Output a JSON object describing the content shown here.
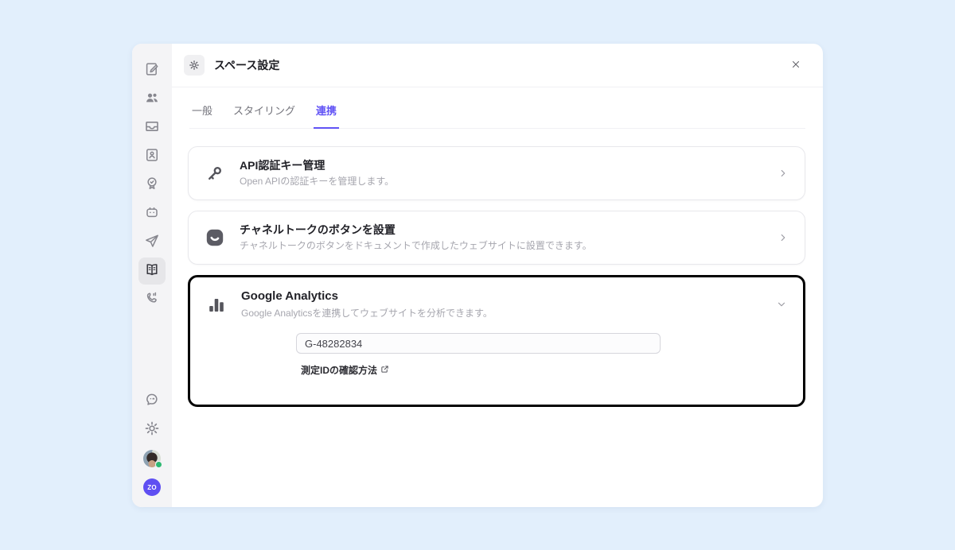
{
  "modal": {
    "title": "スペース設定"
  },
  "tabs": [
    {
      "label": "一般",
      "active": false
    },
    {
      "label": "スタイリング",
      "active": false
    },
    {
      "label": "連携",
      "active": true
    }
  ],
  "cards": {
    "api": {
      "title": "API認証キー管理",
      "subtitle": "Open APIの認証キーを管理します。",
      "chevron": "right"
    },
    "channel_button": {
      "title": "チャネルトークのボタンを設置",
      "subtitle": "チャネルトークのボタンをドキュメントで作成したウェブサイトに設置できます。",
      "chevron": "right"
    },
    "google_analytics": {
      "title": "Google Analytics",
      "subtitle": "Google Analyticsを連携してウェブサイトを分析できます。",
      "chevron": "down",
      "highlighted": true,
      "measurement_id": "G-48282834",
      "help_link": "測定IDの確認方法"
    }
  },
  "sidebar": {
    "items": [
      {
        "icon": "compose-note-icon",
        "active": false
      },
      {
        "icon": "users-icon",
        "active": false
      },
      {
        "icon": "inbox-icon",
        "active": false
      },
      {
        "icon": "contact-card-icon",
        "active": false
      },
      {
        "icon": "badge-check-icon",
        "active": false
      },
      {
        "icon": "bot-icon",
        "active": false
      },
      {
        "icon": "send-icon",
        "active": false
      },
      {
        "icon": "docs-book-icon",
        "active": true
      },
      {
        "icon": "phone-icon",
        "active": false
      },
      {
        "icon": "chat-smiley-icon",
        "active": false
      },
      {
        "icon": "settings-gear-icon",
        "active": false
      },
      {
        "icon": "user-avatar",
        "active": false
      },
      {
        "icon": "workspace-logo",
        "active": false
      }
    ],
    "workspace_logo": "ZO"
  },
  "colors": {
    "background": "#e2effc",
    "accent_purple": "#6153f5",
    "highlight_border": "#000000",
    "online_green": "#2eb872",
    "sidebar_bg": "#f4f4f6"
  }
}
